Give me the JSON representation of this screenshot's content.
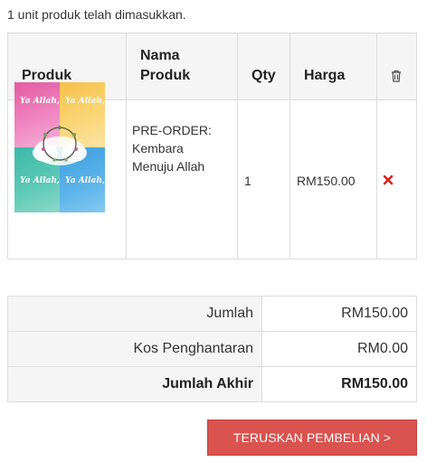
{
  "notice": "1 unit produk telah dimasukkan.",
  "cart": {
    "headers": {
      "product": "Produk",
      "product_name_line1": "Nama",
      "product_name_line2": "Produk",
      "qty": "Qty",
      "price": "Harga",
      "delete_icon": "trash-icon"
    },
    "item": {
      "thumbnail_titles": [
        "Ya Allah,",
        "Ya Allah,",
        "Ya Allah,",
        "Ya Allah,"
      ],
      "name_lines": [
        "PRE-ORDER:",
        "Kembara",
        "Menuju Allah"
      ],
      "qty": "1",
      "price": "RM150.00",
      "remove_icon": "close-icon",
      "remove_color": "#e0211f"
    }
  },
  "totals": [
    {
      "label": "Jumlah",
      "value": "RM150.00"
    },
    {
      "label": "Kos Penghantaran",
      "value": "RM0.00"
    },
    {
      "label": "Jumlah Akhir",
      "value": "RM150.00"
    }
  ],
  "checkout_button": {
    "label": "TERUSKAN PEMBELIAN >",
    "color": "#d9534f"
  }
}
